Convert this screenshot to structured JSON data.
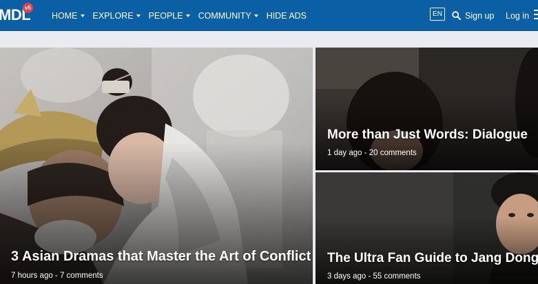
{
  "brand": {
    "logo_text": "MDL",
    "badge": "v5"
  },
  "nav": {
    "items": [
      {
        "label": "HOME",
        "dropdown": true
      },
      {
        "label": "EXPLORE",
        "dropdown": true
      },
      {
        "label": "PEOPLE",
        "dropdown": true
      },
      {
        "label": "COMMUNITY",
        "dropdown": true
      },
      {
        "label": "HIDE ADS",
        "dropdown": false
      }
    ],
    "language": "EN",
    "signup_label": "Sign up",
    "login_label": "Log in"
  },
  "articles": [
    {
      "title": "3 Asian Dramas that Master the Art of Conflict",
      "meta": "7 hours ago - 7 comments"
    },
    {
      "title": "More than Just Words: Dialogue",
      "meta": "1 day ago - 20 comments"
    },
    {
      "title": "The Ultra Fan Guide to Jang Dong Yoon",
      "meta": "3 days ago - 55 comments"
    }
  ],
  "colors": {
    "nav_bg": "#0b5fa5",
    "badge": "#e0434b",
    "page_bg": "#e9ebee"
  }
}
